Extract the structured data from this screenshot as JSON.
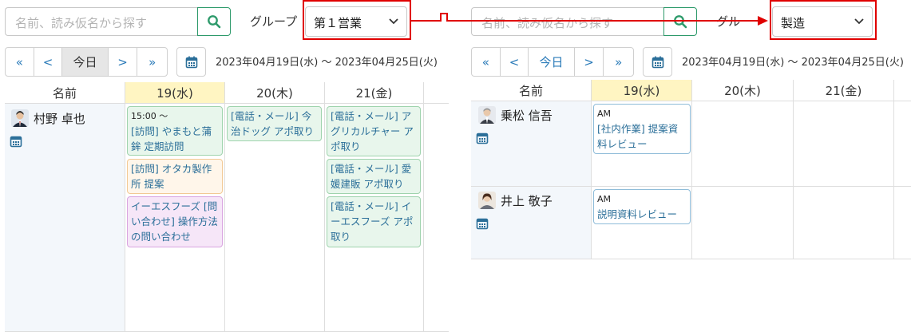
{
  "left": {
    "search": {
      "placeholder": "名前、読み仮名から探す"
    },
    "group_label": "グループ",
    "group_select": "第１営業",
    "nav": {
      "first": "«",
      "prev": "<",
      "today": "今日",
      "next": ">",
      "last": "»"
    },
    "date_range": "2023年04月19日(水) ～ 2023年04月25日(火)",
    "headers": [
      "名前",
      "19(水)",
      "20(木)",
      "21(金)"
    ],
    "person": {
      "name": "村野 卓也"
    },
    "events": {
      "wed": [
        {
          "time": "15:00 ～",
          "text": "[訪問] やまもと蒲鉾 定期訪問",
          "color": "green"
        },
        {
          "text": "[訪問] オタカ製作所 提案",
          "color": "orange"
        },
        {
          "text": "イーエスフーズ [問い合わせ] 操作方法の問い合わせ",
          "color": "purple"
        }
      ],
      "thu": [
        {
          "text": "[電話・メール] 今治ドッグ アポ取り",
          "color": "green"
        }
      ],
      "fri": [
        {
          "text": "[電話・メール] アグリカルチャー アポ取り",
          "color": "green"
        },
        {
          "text": "[電話・メール] 愛媛建販 アポ取り",
          "color": "green"
        },
        {
          "text": "[電話・メール] イーエスフーズ アポ取り",
          "color": "green"
        }
      ]
    }
  },
  "right": {
    "search": {
      "placeholder": "名前、読み仮名から探す"
    },
    "group_label": "グル",
    "group_select": "製造",
    "nav": {
      "first": "«",
      "prev": "<",
      "today": "今日",
      "next": ">",
      "last": "»"
    },
    "date_range": "2023年04月19日(水) ～ 2023年04月25日(火)",
    "headers": [
      "名前",
      "19(水)",
      "20(木)",
      "21(金)"
    ],
    "persons": [
      {
        "name": "乗松 信吾",
        "event": {
          "time": "AM",
          "text": "[社内作業] 提案資料レビュー"
        }
      },
      {
        "name": "井上 敬子",
        "event": {
          "time": "AM",
          "text": "説明資料レビュー"
        }
      }
    ]
  },
  "colors": {
    "accent_green": "#2e9a6b",
    "link_blue": "#2b7bb9",
    "highlight_red": "#e00000",
    "today_header": "#fff5c2"
  },
  "icons": [
    "search-icon",
    "chevron-down-icon",
    "calendar-icon",
    "avatar"
  ]
}
